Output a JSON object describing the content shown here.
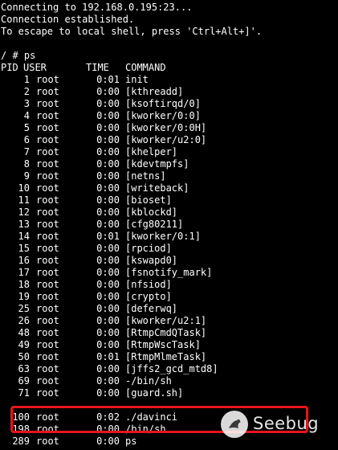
{
  "terminal": {
    "banner": [
      "Connecting to 192.168.0.195:23...",
      "Connection established.",
      "To escape to local shell, press 'Ctrl+Alt+]'."
    ],
    "prompt": "/ # ps",
    "header": {
      "pid": "PID",
      "user": "USER",
      "time": "TIME",
      "command": "COMMAND"
    },
    "rows": [
      {
        "pid": "1",
        "user": "root",
        "time": "0:01",
        "command": "init"
      },
      {
        "pid": "2",
        "user": "root",
        "time": "0:00",
        "command": "[kthreadd]"
      },
      {
        "pid": "3",
        "user": "root",
        "time": "0:00",
        "command": "[ksoftirqd/0]"
      },
      {
        "pid": "4",
        "user": "root",
        "time": "0:00",
        "command": "[kworker/0:0]"
      },
      {
        "pid": "5",
        "user": "root",
        "time": "0:00",
        "command": "[kworker/0:0H]"
      },
      {
        "pid": "6",
        "user": "root",
        "time": "0:00",
        "command": "[kworker/u2:0]"
      },
      {
        "pid": "7",
        "user": "root",
        "time": "0:00",
        "command": "[khelper]"
      },
      {
        "pid": "8",
        "user": "root",
        "time": "0:00",
        "command": "[kdevtmpfs]"
      },
      {
        "pid": "9",
        "user": "root",
        "time": "0:00",
        "command": "[netns]"
      },
      {
        "pid": "10",
        "user": "root",
        "time": "0:00",
        "command": "[writeback]"
      },
      {
        "pid": "11",
        "user": "root",
        "time": "0:00",
        "command": "[bioset]"
      },
      {
        "pid": "12",
        "user": "root",
        "time": "0:00",
        "command": "[kblockd]"
      },
      {
        "pid": "13",
        "user": "root",
        "time": "0:00",
        "command": "[cfg80211]"
      },
      {
        "pid": "14",
        "user": "root",
        "time": "0:01",
        "command": "[kworker/0:1]"
      },
      {
        "pid": "15",
        "user": "root",
        "time": "0:00",
        "command": "[rpciod]"
      },
      {
        "pid": "16",
        "user": "root",
        "time": "0:00",
        "command": "[kswapd0]"
      },
      {
        "pid": "17",
        "user": "root",
        "time": "0:00",
        "command": "[fsnotify_mark]"
      },
      {
        "pid": "18",
        "user": "root",
        "time": "0:00",
        "command": "[nfsiod]"
      },
      {
        "pid": "19",
        "user": "root",
        "time": "0:00",
        "command": "[crypto]"
      },
      {
        "pid": "25",
        "user": "root",
        "time": "0:00",
        "command": "[deferwq]"
      },
      {
        "pid": "26",
        "user": "root",
        "time": "0:00",
        "command": "[kworker/u2:1]"
      },
      {
        "pid": "48",
        "user": "root",
        "time": "0:00",
        "command": "[RtmpCmdQTask]"
      },
      {
        "pid": "49",
        "user": "root",
        "time": "0:00",
        "command": "[RtmpWscTask]"
      },
      {
        "pid": "50",
        "user": "root",
        "time": "0:01",
        "command": "[RtmpMlmeTask]"
      },
      {
        "pid": "63",
        "user": "root",
        "time": "0:00",
        "command": "[jffs2_gcd_mtd8]"
      },
      {
        "pid": "69",
        "user": "root",
        "time": "0:00",
        "command": "-/bin/sh"
      },
      {
        "pid": "71",
        "user": "root",
        "time": "0:00",
        "command": "[guard.sh]"
      },
      {
        "pid": "",
        "user": "",
        "time": "",
        "command": ""
      },
      {
        "pid": "100",
        "user": "root",
        "time": "0:02",
        "command": "./davinci"
      },
      {
        "pid": "198",
        "user": "root",
        "time": "0:00",
        "command": "/bin/sh"
      },
      {
        "pid": "289",
        "user": "root",
        "time": "0:00",
        "command": "ps"
      }
    ],
    "colors": {
      "background": "#000000",
      "text": "#ffffff",
      "highlight": "#e8141c"
    }
  },
  "watermark": {
    "text": "Seebug",
    "icon": "seebug-logo-icon"
  }
}
